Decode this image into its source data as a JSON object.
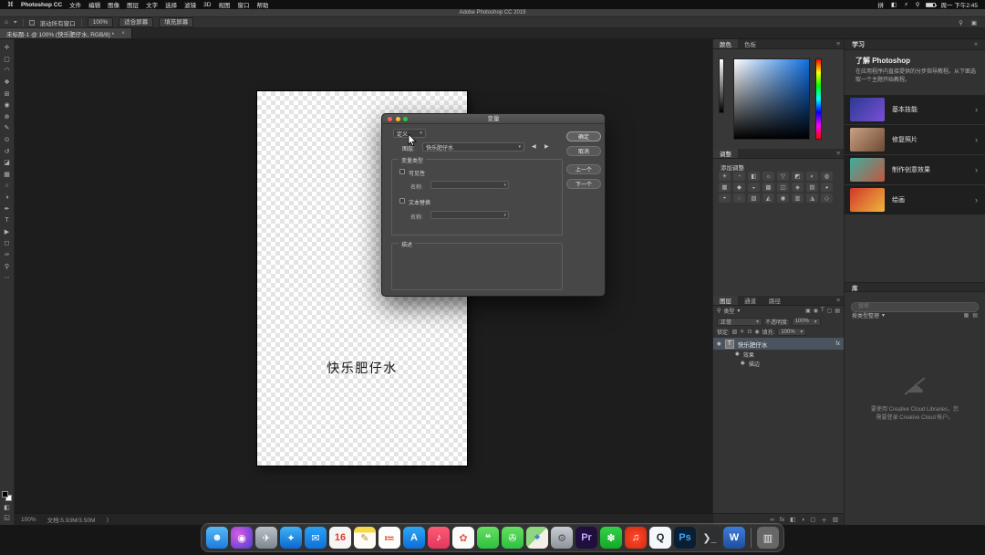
{
  "colors": {
    "accent_blue": "#1473e6",
    "ps_blue": "#31a8ff",
    "selection_row": "#4a545e"
  },
  "menubar": {
    "apple_icon": "⌘",
    "app": "Photoshop CC",
    "items": [
      "文件",
      "编辑",
      "图像",
      "图层",
      "文字",
      "选择",
      "滤镜",
      "3D",
      "视图",
      "窗口",
      "帮助"
    ],
    "status_icons": [
      "拼",
      "◧",
      "⚡",
      "⚲"
    ],
    "time": "周一 下午2:45"
  },
  "titlebar": {
    "title": "Adobe Photoshop CC 2019"
  },
  "options_bar": {
    "home_icon": "⌂",
    "tool_icon": "⌖",
    "scroll_all_label": "滚动所有窗口",
    "btn_100": "100%",
    "btn_fit": "适合屏幕",
    "btn_fill": "填充屏幕",
    "search_icon": "⚲",
    "workspace_icon": "▣"
  },
  "doc_tab": {
    "title": "未标题-1 @ 100% (快乐肥仔水, RGB/8) *",
    "close": "×"
  },
  "toolbar": {
    "tools": [
      {
        "name": "move-tool",
        "glyph": "✛"
      },
      {
        "name": "marquee-tool",
        "glyph": "▢"
      },
      {
        "name": "lasso-tool",
        "glyph": "◠"
      },
      {
        "name": "quick-selection-tool",
        "glyph": "❖"
      },
      {
        "name": "crop-tool",
        "glyph": "⊞"
      },
      {
        "name": "eyedropper-tool",
        "glyph": "◉"
      },
      {
        "name": "healing-brush-tool",
        "glyph": "⊕"
      },
      {
        "name": "brush-tool",
        "glyph": "✎"
      },
      {
        "name": "clone-stamp-tool",
        "glyph": "⊙"
      },
      {
        "name": "history-brush-tool",
        "glyph": "↺"
      },
      {
        "name": "eraser-tool",
        "glyph": "◪"
      },
      {
        "name": "gradient-tool",
        "glyph": "▦"
      },
      {
        "name": "blur-tool",
        "glyph": "○"
      },
      {
        "name": "dodge-tool",
        "glyph": "◑"
      },
      {
        "name": "pen-tool",
        "glyph": "✒"
      },
      {
        "name": "type-tool",
        "glyph": "T"
      },
      {
        "name": "path-select-tool",
        "glyph": "▶"
      },
      {
        "name": "shape-tool",
        "glyph": "◻"
      },
      {
        "name": "hand-tool",
        "glyph": "✑"
      },
      {
        "name": "zoom-tool",
        "glyph": "⚲"
      },
      {
        "name": "edit-toolbar",
        "glyph": "⋯"
      }
    ],
    "quick_mask_icon": "◧",
    "screen_mode_icon": "◱"
  },
  "canvas": {
    "doc_text": "快乐肥仔水"
  },
  "dialog": {
    "title": "变量",
    "define_label": "定义",
    "caret": "▾",
    "layer_label": "图层:",
    "layer_value": "快乐肥仔水",
    "prev_arrow": "◀",
    "next_arrow": "▶",
    "var_type_label": "变量类型",
    "visibility_label": "可见性",
    "name_label": "名称:",
    "text_replace_label": "文本替换",
    "name2_label": "名称:",
    "desc_label": "描述",
    "ok": "确定",
    "cancel": "取消",
    "prev": "上一个",
    "next": "下一个"
  },
  "color_panel": {
    "tab_color": "颜色",
    "tab_swatches": "色板",
    "menu_icon": "≡"
  },
  "adjustments_panel": {
    "tab": "调整",
    "menu_icon": "≡",
    "add_label": "添加调整",
    "icons": [
      "☀",
      "◔",
      "◧",
      "☼",
      "▽",
      "◩",
      "◐",
      "◍",
      "▦",
      "◆",
      "◒",
      "▩",
      "◫",
      "◈",
      "▤",
      "◕",
      "◓",
      "◌",
      "▧",
      "◭",
      "◉",
      "▥",
      "◮",
      "◇"
    ]
  },
  "layers_panel": {
    "tab_layers": "图层",
    "tab_channels": "通道",
    "tab_paths": "路径",
    "menu_icon": "≡",
    "search_icon": "⚲",
    "filter_label": "类型",
    "caret": "▾",
    "filter_icons": [
      "▣",
      "◉",
      "T",
      "▢",
      "▤"
    ],
    "blend_mode": "正常",
    "opacity_label": "不透明度:",
    "opacity_value": "100%",
    "lock_label": "锁定:",
    "lock_icons": [
      "▨",
      "✛",
      "⊡",
      "◉"
    ],
    "fill_label": "填充:",
    "fill_value": "100%",
    "eye_icon": "◉",
    "layer_thumb": "T",
    "layer_name": "快乐肥仔水",
    "fx_label": "fx",
    "sub_effects": "效果",
    "sub_stroke": "描边",
    "footer_icons": [
      "∞",
      "fx",
      "◧",
      "◑",
      "▢",
      "＋",
      "▥"
    ]
  },
  "learn_panel": {
    "title": "学习",
    "collapse_icon": "«",
    "heading": "了解 Photoshop",
    "description": "在应用程序内直接提供的分步指导教程。从下面选取一个主题开始教程。",
    "chevron": "›",
    "items": [
      {
        "name": "learn-item-basics",
        "label": "基本技能",
        "grad": "linear-gradient(135deg,#2b3a8f,#7a4fd8)",
        "chev": "›"
      },
      {
        "name": "learn-item-retouch",
        "label": "修复照片",
        "grad": "linear-gradient(135deg,#caa184,#6e4a33)",
        "chev": "›"
      },
      {
        "name": "learn-item-effects",
        "label": "制作创意效果",
        "grad": "linear-gradient(135deg,#3fae9f,#c2563f)",
        "chev": "›"
      },
      {
        "name": "learn-item-paint",
        "label": "绘画",
        "grad": "linear-gradient(135deg,#d0392b,#efb63c)",
        "chev": "›"
      }
    ]
  },
  "libraries_panel": {
    "tab": "库",
    "search_placeholder": "搜索",
    "sort_label": "按类型整理",
    "caret": "▾",
    "view_icons": [
      "▦",
      "▤"
    ],
    "cloud_icon": "☁",
    "message_line1": "要使用 Creative Cloud Libraries，您",
    "message_line2": "需要登录 Creative Cloud 帐户。"
  },
  "status_bar": {
    "zoom": "100%",
    "doc_info": "文档:5.93M/3.50M",
    "chev": "〉"
  },
  "dock": {
    "items": [
      {
        "name": "dock-finder",
        "glyph": "☻",
        "bg": "linear-gradient(180deg,#55b9f3,#1c7ce0)",
        "color": "#ffffff"
      },
      {
        "name": "dock-siri",
        "glyph": "◉",
        "bg": "radial-gradient(circle at 35% 35%,#d95ce0,#4a3cd6)",
        "color": "#ffffff"
      },
      {
        "name": "dock-launchpad",
        "glyph": "✈",
        "bg": "linear-gradient(180deg,#b9c2c9,#7d868e)",
        "color": "#ffffff"
      },
      {
        "name": "dock-safari",
        "glyph": "✦",
        "bg": "linear-gradient(180deg,#3fb2f5,#0c66cf)",
        "color": "#ffffff"
      },
      {
        "name": "dock-mail",
        "glyph": "✉",
        "bg": "linear-gradient(180deg,#2aa2f5,#0f71d8)",
        "color": "#ffffff"
      },
      {
        "name": "dock-calendar",
        "glyph": "16",
        "bg": "#f5f5f5",
        "color": "#e03b30"
      },
      {
        "name": "dock-notes",
        "glyph": "✎",
        "bg": "linear-gradient(180deg,#f7d94c 28%,#fdfdf5 28%)",
        "color": "#b4912c"
      },
      {
        "name": "dock-reminders",
        "glyph": "≔",
        "bg": "#fdfdfd",
        "color": "#e0552f"
      },
      {
        "name": "dock-appstore",
        "glyph": "A",
        "bg": "linear-gradient(180deg,#2fa7f2,#0e6cd8)",
        "color": "#ffffff"
      },
      {
        "name": "dock-music",
        "glyph": "♪",
        "bg": "linear-gradient(180deg,#fb5c74,#e6355f)",
        "color": "#ffffff"
      },
      {
        "name": "dock-photos",
        "glyph": "✿",
        "bg": "#fbfbfb",
        "color": "#e8584f"
      },
      {
        "name": "dock-messages",
        "glyph": "❝",
        "bg": "linear-gradient(180deg,#67df63,#2cc13e)",
        "color": "#ffffff"
      },
      {
        "name": "dock-facetime",
        "glyph": "✇",
        "bg": "linear-gradient(180deg,#67df63,#2cc13e)",
        "color": "#ffffff"
      },
      {
        "name": "dock-maps",
        "glyph": "⌖",
        "bg": "linear-gradient(135deg,#8fd77f 50%,#f3f0e8 50%)",
        "color": "#3a78d6"
      },
      {
        "name": "dock-settings",
        "glyph": "⚙",
        "bg": "linear-gradient(180deg,#c8cdd2,#8d949b)",
        "color": "#555555"
      },
      {
        "name": "dock-premiere",
        "glyph": "Pr",
        "bg": "#1f0f3d",
        "color": "#c7a9ff"
      },
      {
        "name": "dock-wechat",
        "glyph": "✽",
        "bg": "linear-gradient(180deg,#35d04a,#12a926)",
        "color": "#ffffff"
      },
      {
        "name": "dock-netease-music",
        "glyph": "♫",
        "bg": "radial-gradient(circle,#ff4a2d,#d42a10)",
        "color": "#ffffff"
      },
      {
        "name": "dock-qq",
        "glyph": "Q",
        "bg": "#f4f7fb",
        "color": "#1b1b1b"
      },
      {
        "name": "dock-photoshop",
        "glyph": "Ps",
        "bg": "#0b1f33",
        "color": "#34a8ff"
      },
      {
        "name": "dock-terminal",
        "glyph": "❯_",
        "bg": "#2e2f31",
        "color": "#d7d7d7"
      },
      {
        "name": "dock-word",
        "glyph": "W",
        "bg": "linear-gradient(180deg,#3e7ed8,#1d4e9e)",
        "color": "#ffffff"
      }
    ],
    "trash_glyph": "▥"
  }
}
